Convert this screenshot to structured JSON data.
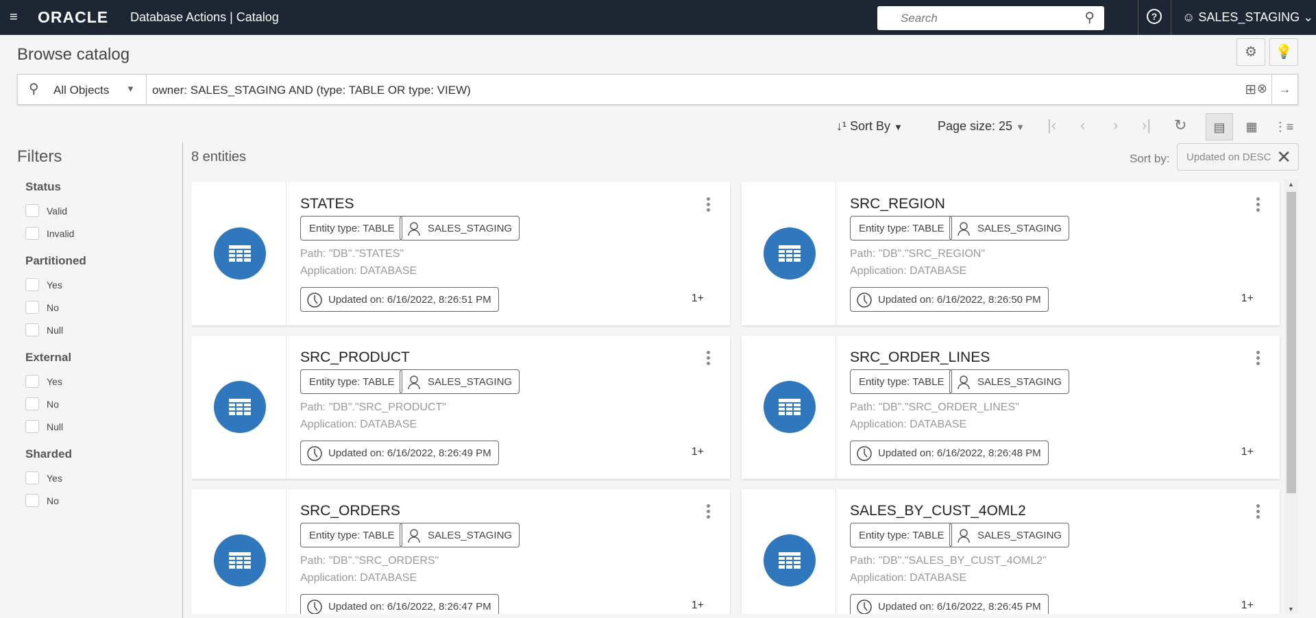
{
  "header": {
    "logo": "ORACLE",
    "app_title": "Database Actions |  Catalog",
    "search_placeholder": "Search",
    "user": "SALES_STAGING"
  },
  "page": {
    "title": "Browse catalog"
  },
  "query": {
    "scope": "All Objects",
    "text": "owner: SALES_STAGING AND (type: TABLE OR type: VIEW)"
  },
  "toolbar": {
    "sort_by": "Sort By",
    "page_size": "Page size: 25"
  },
  "results": {
    "count": "8 entities",
    "sort_label": "Sort by:",
    "sort_chip": "Updated on  DESC"
  },
  "filters": {
    "title": "Filters",
    "groups": [
      {
        "label": "Status",
        "options": [
          "Valid",
          "Invalid"
        ]
      },
      {
        "label": "Partitioned",
        "options": [
          "Yes",
          "No",
          "Null"
        ]
      },
      {
        "label": "External",
        "options": [
          "Yes",
          "No",
          "Null"
        ]
      },
      {
        "label": "Sharded",
        "options": [
          "Yes",
          "No"
        ]
      }
    ]
  },
  "cards": [
    {
      "name": "STATES",
      "type": "Entity type: TABLE",
      "owner": "SALES_STAGING",
      "path": "Path: \"DB\".\"STATES\"",
      "application": "Application: DATABASE",
      "updated": "Updated on: 6/16/2022, 8:26:51 PM",
      "more": "1+"
    },
    {
      "name": "SRC_REGION",
      "type": "Entity type: TABLE",
      "owner": "SALES_STAGING",
      "path": "Path: \"DB\".\"SRC_REGION\"",
      "application": "Application: DATABASE",
      "updated": "Updated on: 6/16/2022, 8:26:50 PM",
      "more": "1+"
    },
    {
      "name": "SRC_PRODUCT",
      "type": "Entity type: TABLE",
      "owner": "SALES_STAGING",
      "path": "Path: \"DB\".\"SRC_PRODUCT\"",
      "application": "Application: DATABASE",
      "updated": "Updated on: 6/16/2022, 8:26:49 PM",
      "more": "1+"
    },
    {
      "name": "SRC_ORDER_LINES",
      "type": "Entity type: TABLE",
      "owner": "SALES_STAGING",
      "path": "Path: \"DB\".\"SRC_ORDER_LINES\"",
      "application": "Application: DATABASE",
      "updated": "Updated on: 6/16/2022, 8:26:48 PM",
      "more": "1+"
    },
    {
      "name": "SRC_ORDERS",
      "type": "Entity type: TABLE",
      "owner": "SALES_STAGING",
      "path": "Path: \"DB\".\"SRC_ORDERS\"",
      "application": "Application: DATABASE",
      "updated": "Updated on: 6/16/2022, 8:26:47 PM",
      "more": "1+"
    },
    {
      "name": "SALES_BY_CUST_4OML2",
      "type": "Entity type: TABLE",
      "owner": "SALES_STAGING",
      "path": "Path: \"DB\".\"SALES_BY_CUST_4OML2\"",
      "application": "Application: DATABASE",
      "updated": "Updated on: 6/16/2022, 8:26:45 PM",
      "more": "1+"
    }
  ],
  "colors": {
    "header_bg": "#1e2633",
    "icon_blue": "#2f78bd"
  }
}
